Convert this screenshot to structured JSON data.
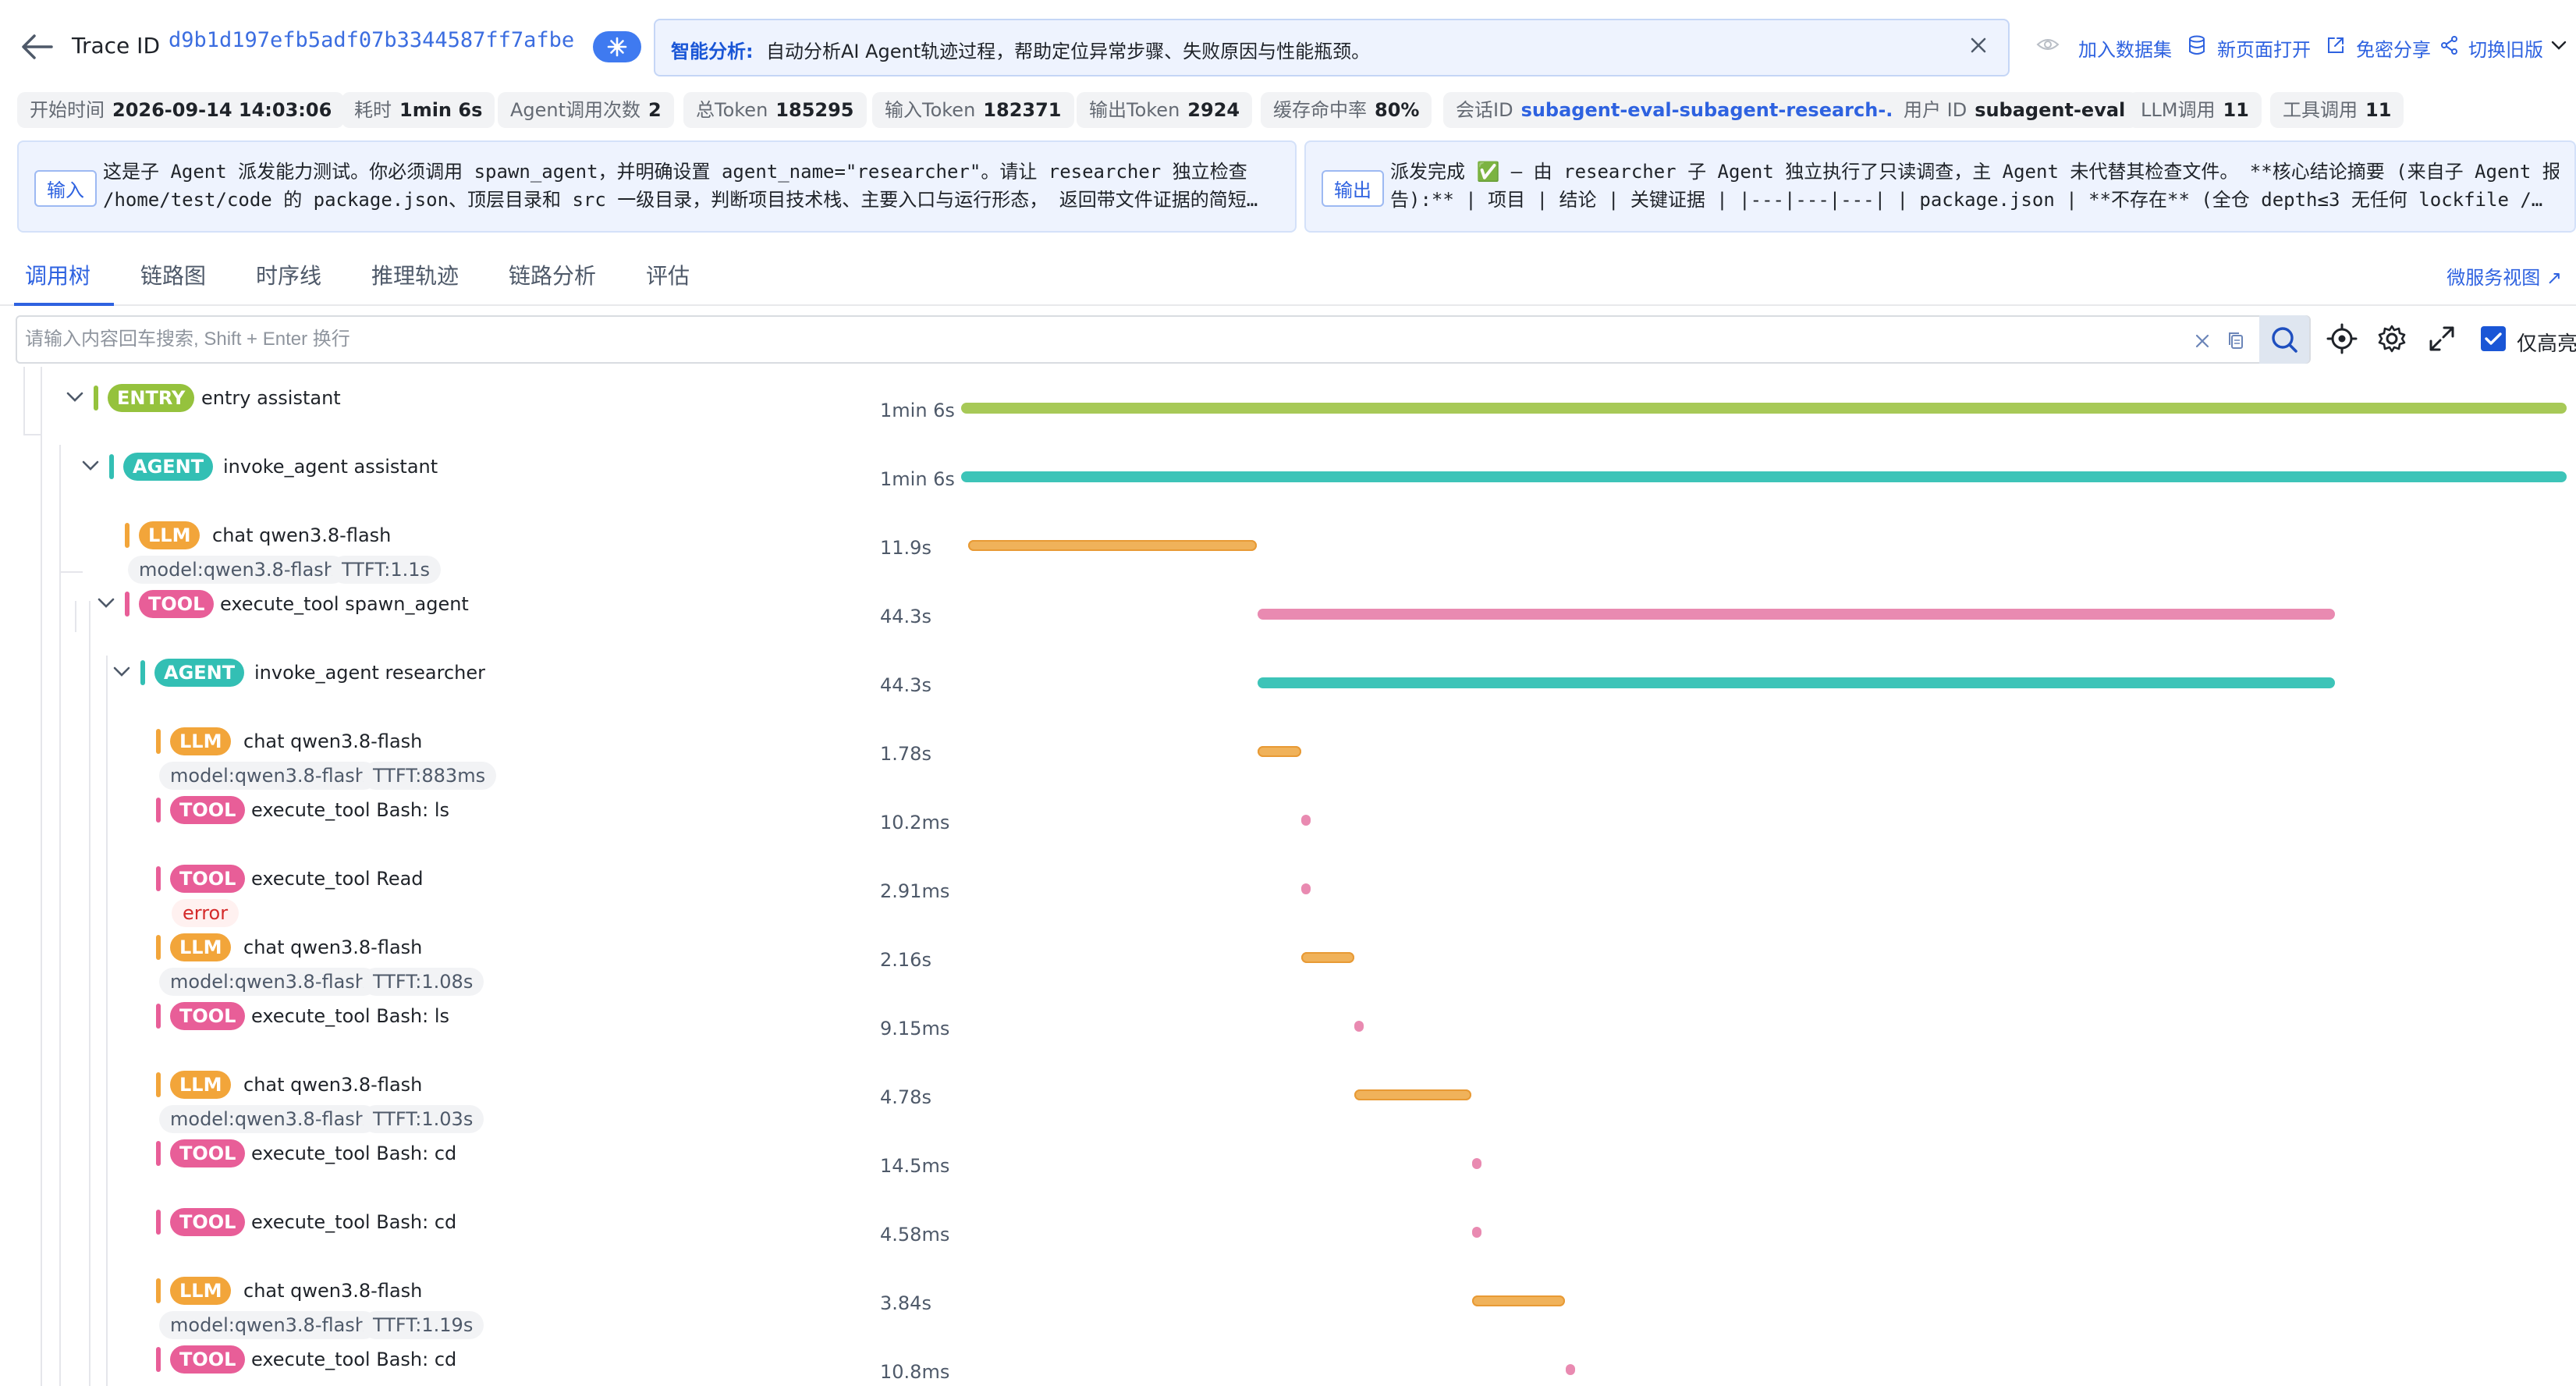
{
  "header": {
    "back": "back-arrow",
    "trace_label": "Trace ID",
    "trace_id": "d9b1d197efb5adf07b3344587ff7afbe",
    "ai_title": "智能分析:",
    "ai_text": "自动分析AI Agent轨迹过程，帮助定位异常步骤、失败原因与性能瓶颈。",
    "links": {
      "add_dataset": "加入数据集",
      "new_page": "新页面打开",
      "share": "免密分享",
      "old_version": "切换旧版"
    }
  },
  "stats": {
    "start_time": {
      "label": "开始时间",
      "value": "2026-09-14 14:03:06"
    },
    "duration": {
      "label": "耗时",
      "value": "1min 6s"
    },
    "agent_calls": {
      "label": "Agent调用次数",
      "value": "2"
    },
    "total_token": {
      "label": "总Token",
      "value": "185295"
    },
    "input_token": {
      "label": "输入Token",
      "value": "182371"
    },
    "output_token": {
      "label": "输出Token",
      "value": "2924"
    },
    "cache_hit": {
      "label": "缓存命中率",
      "value": "80%"
    },
    "session": {
      "label": "会话ID",
      "value": "subagent-eval-subagent-research-..."
    },
    "user": {
      "label": "用户 ID",
      "value": "subagent-eval"
    },
    "llm_calls": {
      "label": "LLM调用",
      "value": "11"
    },
    "tool_calls": {
      "label": "工具调用",
      "value": "11"
    }
  },
  "io": {
    "input_tag": "输入",
    "input_text": "这是子 Agent 派发能力测试。你必须调用 spawn_agent，并明确设置 agent_name=\"researcher\"。请让 researcher 独立检查\n/home/test/code 的 package.json、顶层目录和 src 一级目录，判断项目技术栈、主要入口与运行形态， 返回带文件证据的简短…",
    "output_tag": "输出",
    "output_text": "派发完成 ✅ — 由 researcher 子 Agent 独立执行了只读调查，主 Agent 未代替其检查文件。 **核心结论摘要 (来自子 Agent 报\n告):** | 项目 | 结论 | 关键证据 | |---|---|---| | package.json | **不存在** (全仓 depth≤3 无任何 lockfile /…"
  },
  "tabs": [
    "调用树",
    "链路图",
    "时序线",
    "推理轨迹",
    "链路分析",
    "评估"
  ],
  "active_tab": "调用树",
  "microservice_view": "微服务视图",
  "search": {
    "placeholder": "请输入内容回车搜索, Shift + Enter 换行",
    "highlight_only": "仅高亮"
  },
  "tree_rows": [
    {
      "kind": "ENTRY",
      "name": "entry assistant",
      "duration": "1min 6s",
      "start": 0.0,
      "span": 1.0
    },
    {
      "kind": "AGENT",
      "name": "invoke_agent assistant",
      "duration": "1min 6s",
      "start": 0.0,
      "span": 1.0
    },
    {
      "kind": "LLM",
      "name": "chat qwen3.8-flash",
      "duration": "11.9s",
      "start": 0.0045,
      "span": 0.18,
      "model": "model:qwen3.8-flash",
      "ttft": "TTFT:1.1s"
    },
    {
      "kind": "TOOL",
      "name": "execute_tool spawn_agent",
      "duration": "44.3s",
      "start": 0.1845,
      "span": 0.671
    },
    {
      "kind": "AGENT",
      "name": "invoke_agent researcher",
      "duration": "44.3s",
      "start": 0.1845,
      "span": 0.671
    },
    {
      "kind": "LLM",
      "name": "chat qwen3.8-flash",
      "duration": "1.78s",
      "start": 0.1845,
      "span": 0.027,
      "model": "model:qwen3.8-flash",
      "ttft": "TTFT:883ms"
    },
    {
      "kind": "TOOL",
      "name": "execute_tool Bash: ls",
      "duration": "10.2ms",
      "start": 0.212
    },
    {
      "kind": "TOOL",
      "name": "execute_tool Read",
      "duration": "2.91ms",
      "start": 0.212,
      "error": "error"
    },
    {
      "kind": "LLM",
      "name": "chat qwen3.8-flash",
      "duration": "2.16s",
      "start": 0.212,
      "span": 0.033,
      "model": "model:qwen3.8-flash",
      "ttft": "TTFT:1.08s"
    },
    {
      "kind": "TOOL",
      "name": "execute_tool Bash: ls",
      "duration": "9.15ms",
      "start": 0.245
    },
    {
      "kind": "LLM",
      "name": "chat qwen3.8-flash",
      "duration": "4.78s",
      "start": 0.245,
      "span": 0.073,
      "model": "model:qwen3.8-flash",
      "ttft": "TTFT:1.03s"
    },
    {
      "kind": "TOOL",
      "name": "execute_tool Bash: cd",
      "duration": "14.5ms",
      "start": 0.3185
    },
    {
      "kind": "TOOL",
      "name": "execute_tool Bash: cd",
      "duration": "4.58ms",
      "start": 0.3185
    },
    {
      "kind": "LLM",
      "name": "chat qwen3.8-flash",
      "duration": "3.84s",
      "start": 0.3185,
      "span": 0.058,
      "model": "model:qwen3.8-flash",
      "ttft": "TTFT:1.19s"
    },
    {
      "kind": "TOOL",
      "name": "execute_tool Bash: cd",
      "duration": "10.8ms",
      "start": 0.3765
    }
  ],
  "colors": {
    "ENTRY": "#95c23d",
    "AGENT": "#33bfb4",
    "LLM": "#f2a53a",
    "TOOL": "#e85e98",
    "bar_ENTRY": "#a7c957",
    "bar_AGENT": "#3dc4b8",
    "bar_LLM": "#f0b25a",
    "bar_TOOL": "#e98ab1"
  }
}
